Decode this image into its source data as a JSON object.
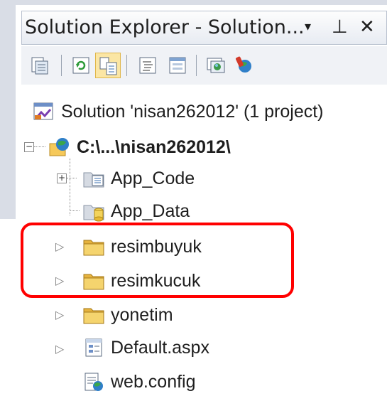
{
  "window": {
    "title": "Solution Explorer - Solution...",
    "dropdown_glyph": "▾",
    "pin_glyph": "⊥",
    "close_glyph": "✕"
  },
  "toolbar": {
    "buttons": [
      {
        "icon": "properties-icon"
      },
      {
        "icon": "refresh-icon"
      },
      {
        "icon": "show-all-files-icon",
        "active": true
      },
      {
        "icon": "view-code-icon"
      },
      {
        "icon": "view-designer-icon"
      },
      {
        "icon": "browser-icon"
      },
      {
        "icon": "configuration-icon"
      }
    ]
  },
  "tree": {
    "solution": "Solution 'nisan262012' (1 project)",
    "project": "C:\\...\\nisan262012\\",
    "items": [
      {
        "label": "App_Code"
      },
      {
        "label": "App_Data"
      },
      {
        "label": "resimbuyuk"
      },
      {
        "label": "resimkucuk"
      },
      {
        "label": "yonetim"
      },
      {
        "label": "Default.aspx"
      },
      {
        "label": "web.config"
      }
    ],
    "collapsed_glyph": "▷",
    "collapse_box": "−",
    "expand_box": "+"
  },
  "colors": {
    "highlight": "#ff0000",
    "folder": "#f2c14e",
    "active_button": "#fbe6a4"
  }
}
